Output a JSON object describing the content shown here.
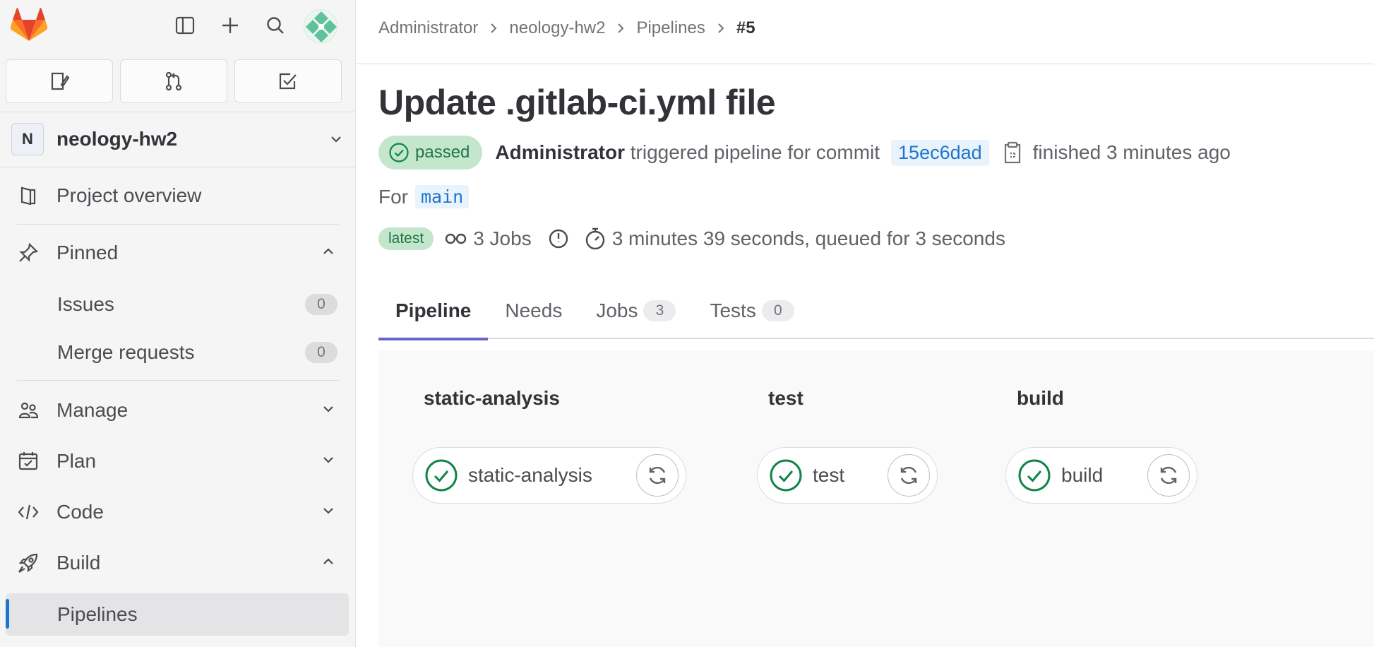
{
  "sidebar": {
    "project": {
      "avatar_letter": "N",
      "name": "neology-hw2"
    },
    "items": {
      "overview": "Project overview",
      "pinned": "Pinned",
      "issues": "Issues",
      "issues_count": "0",
      "merge_requests": "Merge requests",
      "merge_requests_count": "0",
      "manage": "Manage",
      "plan": "Plan",
      "code": "Code",
      "build": "Build",
      "pipelines": "Pipelines"
    }
  },
  "breadcrumb": {
    "c1": "Administrator",
    "c2": "neology-hw2",
    "c3": "Pipelines",
    "current": "#5"
  },
  "pipeline": {
    "title": "Update .gitlab-ci.yml file",
    "status": "passed",
    "author": "Administrator",
    "trigger_text": "triggered pipeline for commit",
    "sha": "15ec6dad",
    "finished": "finished 3 minutes ago",
    "for_label": "For",
    "branch": "main",
    "latest_badge": "latest",
    "jobs_count": "3 Jobs",
    "duration": "3 minutes 39 seconds, queued for 3 seconds"
  },
  "tabs": {
    "pipeline": "Pipeline",
    "needs": "Needs",
    "jobs": "Jobs",
    "jobs_count": "3",
    "tests": "Tests",
    "tests_count": "0"
  },
  "stages": [
    {
      "name": "static-analysis",
      "job": "static-analysis"
    },
    {
      "name": "test",
      "job": "test"
    },
    {
      "name": "build",
      "job": "build"
    }
  ],
  "colors": {
    "success": "#108548",
    "link": "#1f75cb",
    "active_tab": "#6666c4"
  }
}
